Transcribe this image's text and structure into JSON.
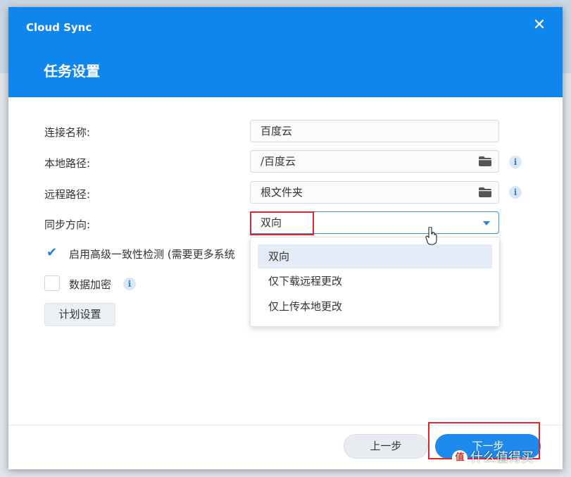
{
  "dialog": {
    "app_title": "Cloud Sync",
    "close_glyph": "✕",
    "section_title": "任务设置"
  },
  "form": {
    "connection_name": {
      "label": "连接名称:",
      "value": "百度云"
    },
    "local_path": {
      "label": "本地路径:",
      "value": "/百度云",
      "icon": "folder-icon"
    },
    "remote_path": {
      "label": "远程路径:",
      "value": "根文件夹",
      "icon": "folder-icon"
    },
    "sync_direction": {
      "label": "同步方向:",
      "value": "双向",
      "options": [
        "双向",
        "仅下载远程更改",
        "仅上传本地更改"
      ],
      "selected_option": "双向"
    },
    "consistency_check": {
      "label": "启用高级一致性检测 (需要更多系统",
      "checked": true
    },
    "encryption": {
      "label": "数据加密",
      "checked": false
    },
    "info_glyph": "i",
    "schedule_button": "计划设置"
  },
  "footer": {
    "prev_button": "上一步",
    "next_button": "下一步"
  },
  "watermark": {
    "logo": "值",
    "text": "什么值得买"
  },
  "colors": {
    "accent": "#0f86ee",
    "highlight": "#e0262a"
  }
}
